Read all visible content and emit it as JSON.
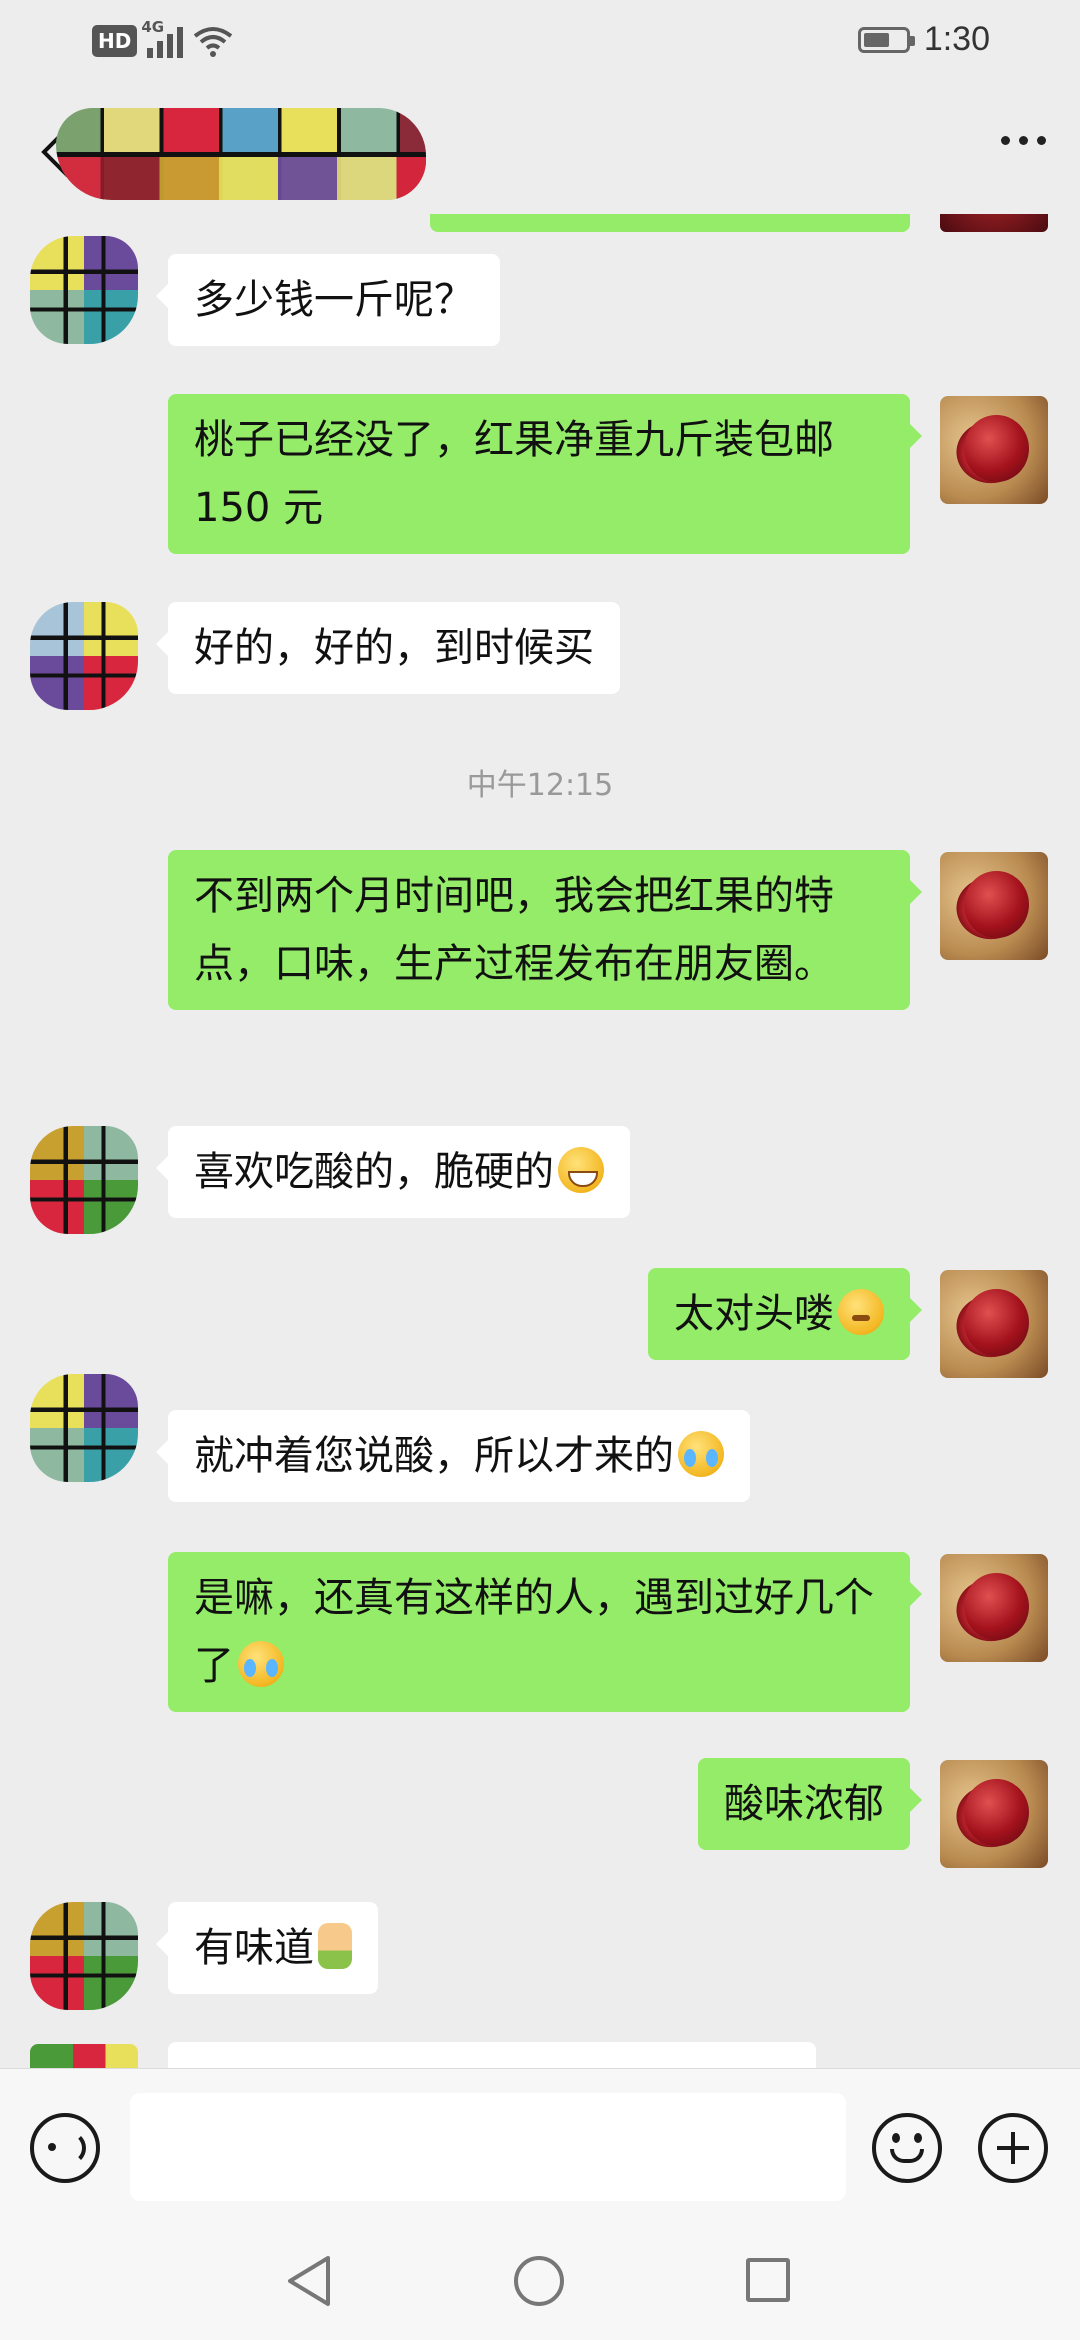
{
  "status_bar": {
    "network_badge": "HD",
    "network_gen": "4G",
    "time": "1:30",
    "icons": [
      "hd-icon",
      "signal-icon",
      "wifi-icon",
      "battery-icon"
    ]
  },
  "header": {
    "back_icon": "chevron-left-icon",
    "title": "",
    "more_icon": "more-horizontal-icon"
  },
  "messages": [
    {
      "side": "in",
      "text": "多少钱一斤呢？"
    },
    {
      "side": "out",
      "text": "桃子已经没了，红果净重九斤装包邮 150 元"
    },
    {
      "side": "in",
      "text": "好的，好的，到时候买"
    },
    {
      "side": "out",
      "text": "不到两个月时间吧，我会把红果的特点，口味，生产过程发布在朋友圈。"
    },
    {
      "side": "in",
      "text": "喜欢吃酸的，脆硬的",
      "emoji": "grinning-face"
    },
    {
      "side": "out",
      "text": "太对头喽",
      "emoji": "thinking-face"
    },
    {
      "side": "in",
      "text": "就冲着您说酸，所以才来的",
      "emoji": "laughing-tears-face"
    },
    {
      "side": "out",
      "text": "是嘛，还真有这样的人，遇到过好几个了",
      "emoji": "laughing-tears-face"
    },
    {
      "side": "out",
      "text": "酸味浓郁"
    },
    {
      "side": "in",
      "text": "有味道",
      "emoji": "thumbs-up"
    }
  ],
  "timestamp": "中午12:15",
  "input_bar": {
    "voice_icon": "voice-icon",
    "message_value": "",
    "emoji_icon": "emoji-icon",
    "plus_icon": "plus-icon"
  },
  "nav_bar": {
    "icons": [
      "back-triangle-icon",
      "home-circle-icon",
      "recents-square-icon"
    ]
  },
  "colors": {
    "background": "#ededed",
    "outgoing_bubble": "#95ec69",
    "incoming_bubble": "#ffffff",
    "timestamp_text": "#999999"
  }
}
